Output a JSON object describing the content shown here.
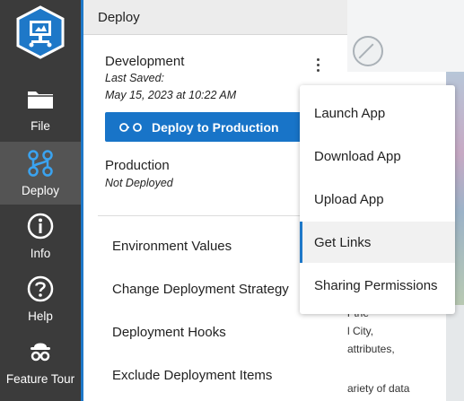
{
  "sidebar": {
    "items": [
      {
        "label": "File",
        "icon": "folder-icon"
      },
      {
        "label": "Deploy",
        "icon": "deploy-icon"
      },
      {
        "label": "Info",
        "icon": "info-icon"
      },
      {
        "label": "Help",
        "icon": "help-icon"
      },
      {
        "label": "Feature Tour",
        "icon": "feature-tour-icon"
      }
    ]
  },
  "panel": {
    "title": "Deploy",
    "development": {
      "name": "Development",
      "last_saved_label": "Last Saved:",
      "last_saved_date": "May 15, 2023 at 10:22 AM"
    },
    "deploy_button": "Deploy to Production",
    "production": {
      "name": "Production",
      "status": "Not Deployed"
    },
    "links": [
      "Environment Values",
      "Change Deployment Strategy",
      "Deployment Hooks",
      "Exclude Deployment Items"
    ]
  },
  "dropdown": {
    "items": [
      "Launch App",
      "Download App",
      "Upload App",
      "Get Links",
      "Sharing Permissions"
    ],
    "highlighted": "Get Links"
  },
  "background": {
    "text_lines": [
      "r the",
      "l City,",
      "attributes,",
      "ariety of data"
    ]
  },
  "colors": {
    "sidebar": "#3b3b3b",
    "sidebar_active": "#545454",
    "accent": "#1e78c8",
    "button": "#1874c8"
  }
}
